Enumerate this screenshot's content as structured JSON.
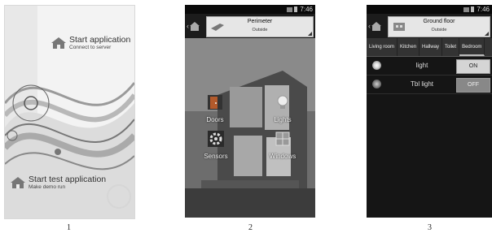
{
  "screen1": {
    "start_application": {
      "title": "Start application",
      "subtitle": "Connect to server"
    },
    "start_test_application": {
      "title": "Start test application",
      "subtitle": "Make demo run"
    }
  },
  "screen2": {
    "status": {
      "time": "7:46"
    },
    "header": {
      "title": "Perimeter",
      "subtitle": "Outside"
    },
    "tiles": [
      {
        "label": "Doors"
      },
      {
        "label": "Lights"
      },
      {
        "label": "Sensors"
      },
      {
        "label": "Windows"
      }
    ]
  },
  "screen3": {
    "status": {
      "time": "7:46"
    },
    "header": {
      "title": "Ground floor",
      "subtitle": "Outside"
    },
    "tabs": [
      "Living room",
      "Kitchen",
      "Hallway",
      "Toilet",
      "Bedroom"
    ],
    "devices": [
      {
        "name": "light",
        "state": "ON"
      },
      {
        "name": "Tbl light",
        "state": "OFF"
      }
    ]
  },
  "figure_numbers": [
    "1",
    "2",
    "3"
  ]
}
